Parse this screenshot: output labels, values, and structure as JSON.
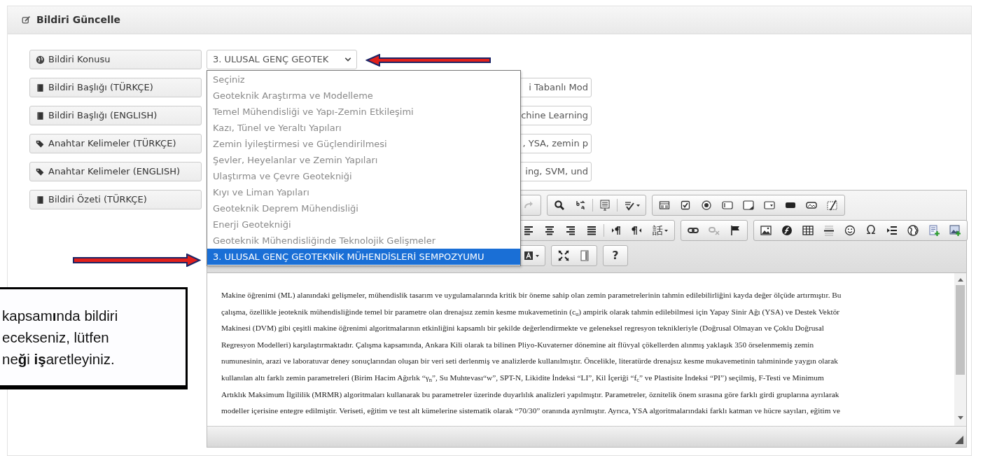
{
  "panel": {
    "title": "Bildiri Güncelle"
  },
  "fields": [
    {
      "label": "Bildiri Konusu",
      "kind": "select",
      "value": "3. ULUSAL GENÇ GEOTEK",
      "expanded": true,
      "options": [
        {
          "label": "Seçiniz",
          "selected": false
        },
        {
          "label": "Geoteknik Araştırma ve Modelleme",
          "selected": false
        },
        {
          "label": "Temel Mühendisliği ve Yapı-Zemin Etkileşimi",
          "selected": false
        },
        {
          "label": "Kazı, Tünel ve Yeraltı Yapıları",
          "selected": false
        },
        {
          "label": "Zemin İyileştirmesi ve Güçlendirilmesi",
          "selected": false
        },
        {
          "label": "Şevler, Heyelanlar ve Zemin Yapıları",
          "selected": false
        },
        {
          "label": "Ulaştırma ve Çevre Geotekniği",
          "selected": false
        },
        {
          "label": "Kıyı ve Liman Yapıları",
          "selected": false
        },
        {
          "label": "Geoteknik Deprem Mühendisliği",
          "selected": false
        },
        {
          "label": "Enerji Geotekniği",
          "selected": false
        },
        {
          "label": "Geoteknik Mühendisliğinde Teknolojik Gelişmeler",
          "selected": false
        },
        {
          "label": "3. ULUSAL GENÇ GEOTEKNİK MÜHENDİSLERİ SEMPOZYUMU",
          "selected": true
        }
      ]
    },
    {
      "label": "Bildiri Başlığı (TÜRKÇE)",
      "kind": "text",
      "value": "i Tabanlı Mod"
    },
    {
      "label": "Bildiri Başlığı (ENGLISH)",
      "kind": "text",
      "value": "chine Learning"
    },
    {
      "label": "Anahtar Kelimeler (TÜRKÇE)",
      "kind": "text",
      "value": ", YSA, zemin p"
    },
    {
      "label": "Anahtar Kelimeler (ENGLISH)",
      "kind": "text",
      "value": "ing, SVM, und"
    },
    {
      "label": "Bildiri Özeti (TÜRKÇE)",
      "kind": "editor"
    }
  ],
  "editor": {
    "toolbar": {
      "redo": {
        "disabled": true
      },
      "unlink": {
        "disabled": true
      },
      "language": {
        "label": "話"
      },
      "special_char": {
        "label": "Ω"
      },
      "help": {
        "label": "?"
      }
    },
    "content": [
      "Makine öğrenimi (ML) alanındaki gelişmeler, mühendislik tasarım ve uygulamalarında kritik bir öneme sahip olan zemin parametrelerinin tahmin edilebilirliğini kayda değer ölçüde artırmıştır. Bu",
      "çalışma, özellikle jeoteknik mühendisliğinde temel bir parametre olan drenajsız zemin kesme mukavemetinin (c$_{u}$) ampirik olarak tahmin edilebilmesi için Yapay Sinir Ağı (YSA) ve Destek Vektör",
      "Makinesi (DVM) gibi çeşitli makine öğrenimi algoritmalarının etkinliğini kapsamlı bir şekilde değerlendirmekte ve geleneksel regresyon teknikleriyle (Doğrusal Olmayan ve Çoklu Doğrusal",
      "Regresyon Modelleri) karşılaştırmaktadır. Çalışma kapsamında, Ankara Kili olarak ta bilinen Pliyo-Kuvaterner dönemine ait flüvyal çökellerden alınmış yaklaşık 350 örselenmemiş zemin",
      "numunesinin, arazi ve laboratuvar deney sonuçlarından oluşan bir veri seti derlenmiş ve analizlerde kullanılmıştır. Öncelikle, literatürde drenajsız kesme mukavemetinin tahmininde yaygın olarak",
      "kullanılan altı farklı zemin parametreleri (Birim Hacim Ağırlık “γ$_{n}$”, Su Muhtevası“w”, SPT-N, Likidite İndeksi “LI”, Kil İçeriği “f$_{c}$” ve Plastisite İndeksi “PI”) seçilmiş, F-Testi ve Minimum",
      "Artıklık Maksimum İlgililik (MRMR) algoritmaları kullanarak bu parametreler üzerinde duyarlılık analizleri yapılmıştır. Parametreler, öznitelik önem sırasına göre farklı girdi gruplarına ayrılarak",
      "modeller içerisine entegre edilmiştir. Veriseti, eğitim ve test alt kümelerine sistematik olarak “70/30” oranında ayrılmıştır. Ayrıca, YSA algoritmalarındaki farklı katman ve hücre sayıları, eğitim ve"
    ]
  },
  "callout": {
    "lines": [
      "kapsam**ı**nda bildiri",
      "ecekseniz, lütfen",
      "ne**ğ**i **iş**aretleyiniz."
    ]
  }
}
